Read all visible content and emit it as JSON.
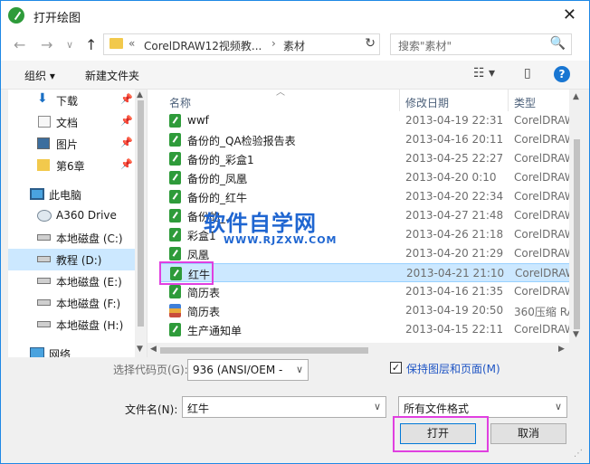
{
  "window": {
    "title": "打开绘图",
    "close_label": "✕"
  },
  "nav": {
    "back": "←",
    "forward": "→",
    "recent": "∨",
    "up": "↑",
    "address": {
      "overflow": "«",
      "segment1": "CorelDRAW12视频教...",
      "separator": "›",
      "segment2": "素材"
    },
    "refresh": "↻",
    "search_placeholder": "搜索\"素材\"",
    "search_icon": "🔍"
  },
  "toolbar": {
    "organize_label": "组织 ▾",
    "new_folder_label": "新建文件夹",
    "view_icon": "☷ ▾",
    "pane_icon": "▯",
    "help_label": "?"
  },
  "sidebar": {
    "items": [
      {
        "label": "下载",
        "icon": "download-icon",
        "pinned": "📌"
      },
      {
        "label": "文档",
        "icon": "document-icon",
        "pinned": "📌"
      },
      {
        "label": "图片",
        "icon": "picture-icon",
        "pinned": "📌"
      },
      {
        "label": "第6章",
        "icon": "folder-icon",
        "pinned": "📌"
      },
      {
        "label": "此电脑",
        "icon": "computer-icon"
      },
      {
        "label": "A360 Drive",
        "icon": "cloud-drive-icon"
      },
      {
        "label": "本地磁盘 (C:)",
        "icon": "drive-icon"
      },
      {
        "label": "教程 (D:)",
        "icon": "drive-icon"
      },
      {
        "label": "本地磁盘 (E:)",
        "icon": "drive-icon"
      },
      {
        "label": "本地磁盘 (F:)",
        "icon": "drive-icon"
      },
      {
        "label": "本地磁盘 (H:)",
        "icon": "drive-icon"
      },
      {
        "label": "网络",
        "icon": "network-icon"
      }
    ]
  },
  "file_list": {
    "columns": {
      "name": "名称",
      "date": "修改日期",
      "type": "类型"
    },
    "rows": [
      {
        "name": "wwf",
        "date": "2013-04-19 22:31",
        "type": "CorelDRAW",
        "icon": "cdr"
      },
      {
        "name": "备份的_QA检验报告表",
        "date": "2013-04-16 20:11",
        "type": "CorelDRAW",
        "icon": "cdr"
      },
      {
        "name": "备份的_彩盒1",
        "date": "2013-04-25 22:27",
        "type": "CorelDRAW",
        "icon": "cdr"
      },
      {
        "name": "备份的_凤凰",
        "date": "2013-04-20 0:10",
        "type": "CorelDRAW",
        "icon": "cdr"
      },
      {
        "name": "备份的_红牛",
        "date": "2013-04-20 22:34",
        "type": "CorelDRAW",
        "icon": "cdr"
      },
      {
        "name": "备份的_...",
        "date": "2013-04-27 21:48",
        "type": "CorelDRAW",
        "icon": "cdr"
      },
      {
        "name": "彩盒1",
        "date": "2013-04-26 21:18",
        "type": "CorelDRAW",
        "icon": "cdr"
      },
      {
        "name": "凤凰",
        "date": "2013-04-20 21:29",
        "type": "CorelDRAW",
        "icon": "cdr"
      },
      {
        "name": "红牛",
        "date": "2013-04-21 21:10",
        "type": "CorelDRAW",
        "icon": "cdr"
      },
      {
        "name": "简历表",
        "date": "2013-04-16 21:35",
        "type": "CorelDRAW",
        "icon": "cdr"
      },
      {
        "name": "简历表",
        "date": "2013-04-19 20:50",
        "type": "360压缩 RA",
        "icon": "zip"
      },
      {
        "name": "生产通知单",
        "date": "2013-04-15 22:11",
        "type": "CorelDRAW",
        "icon": "cdr"
      }
    ]
  },
  "watermark": {
    "title": "软件自学网",
    "url": "WWW.RJZXW.COM"
  },
  "bottom": {
    "codepage_label": "选择代码页(G):",
    "codepage_value": "936  (ANSI/OEM -",
    "keep_layers_label": "保持图层和页面(M)",
    "keep_layers_checked": "✓",
    "filename_label": "文件名(N):",
    "filename_value": "红牛",
    "filetype_value": "所有文件格式",
    "open_button": "打开",
    "cancel_button": "取消",
    "dropdown_arrow": "∨"
  },
  "colors": {
    "accent": "#1e88e5",
    "selection": "#cce8ff",
    "highlight": "#e040e0",
    "cdr_icon": "#2e9b3a"
  }
}
